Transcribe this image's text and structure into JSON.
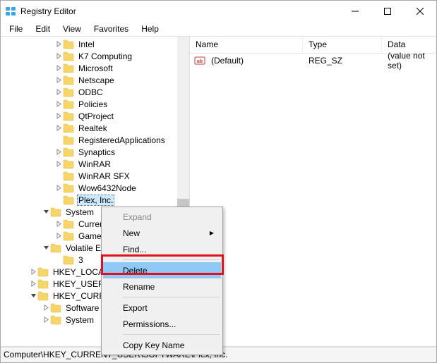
{
  "window": {
    "title": "Registry Editor"
  },
  "menubar": {
    "items": [
      "File",
      "Edit",
      "View",
      "Favorites",
      "Help"
    ]
  },
  "tree": {
    "items": [
      {
        "label": "Intel",
        "depth": 4,
        "exp": ">",
        "open": false
      },
      {
        "label": "K7 Computing",
        "depth": 4,
        "exp": ">",
        "open": false
      },
      {
        "label": "Microsoft",
        "depth": 4,
        "exp": ">",
        "open": false
      },
      {
        "label": "Netscape",
        "depth": 4,
        "exp": ">",
        "open": false
      },
      {
        "label": "ODBC",
        "depth": 4,
        "exp": ">",
        "open": false
      },
      {
        "label": "Policies",
        "depth": 4,
        "exp": ">",
        "open": false
      },
      {
        "label": "QtProject",
        "depth": 4,
        "exp": ">",
        "open": false
      },
      {
        "label": "Realtek",
        "depth": 4,
        "exp": ">",
        "open": false
      },
      {
        "label": "RegisteredApplications",
        "depth": 4,
        "exp": "",
        "open": false
      },
      {
        "label": "Synaptics",
        "depth": 4,
        "exp": ">",
        "open": false
      },
      {
        "label": "WinRAR",
        "depth": 4,
        "exp": ">",
        "open": false
      },
      {
        "label": "WinRAR SFX",
        "depth": 4,
        "exp": "",
        "open": false
      },
      {
        "label": "Wow6432Node",
        "depth": 4,
        "exp": ">",
        "open": false
      },
      {
        "label": "Plex, Inc.",
        "depth": 4,
        "exp": "",
        "open": false,
        "selected": true
      },
      {
        "label": "System",
        "depth": 3,
        "exp": "v",
        "open": true
      },
      {
        "label": "CurrentControlSet",
        "depth": 4,
        "exp": ">",
        "open": false,
        "truncated": "Curren"
      },
      {
        "label": "GameConfigStore",
        "depth": 4,
        "exp": ">",
        "open": false,
        "truncated": "Game"
      },
      {
        "label": "Volatile Environment",
        "depth": 3,
        "exp": "v",
        "open": true,
        "truncated": "Volatile En"
      },
      {
        "label": "3",
        "depth": 4,
        "exp": "",
        "open": false
      },
      {
        "label": "HKEY_LOCAL_MACHINE",
        "depth": 2,
        "exp": ">",
        "open": false,
        "truncated": "HKEY_LOCAL"
      },
      {
        "label": "HKEY_USERS",
        "depth": 2,
        "exp": ">",
        "open": false,
        "truncated": "HKEY_USERS"
      },
      {
        "label": "HKEY_CURRENT_CONFIG",
        "depth": 2,
        "exp": "v",
        "open": true,
        "truncated": "HKEY_CURRE"
      },
      {
        "label": "Software",
        "depth": 3,
        "exp": ">",
        "open": false
      },
      {
        "label": "System",
        "depth": 3,
        "exp": ">",
        "open": false
      }
    ]
  },
  "list": {
    "headers": {
      "name": "Name",
      "type": "Type",
      "data": "Data"
    },
    "rows": [
      {
        "name": "(Default)",
        "type": "REG_SZ",
        "data": "(value not set)"
      }
    ]
  },
  "context_menu": {
    "items": [
      {
        "label": "Expand",
        "kind": "item",
        "disabled": true
      },
      {
        "label": "New",
        "kind": "submenu"
      },
      {
        "label": "Find...",
        "kind": "item"
      },
      {
        "kind": "sep"
      },
      {
        "label": "Delete",
        "kind": "item",
        "highlight": true
      },
      {
        "label": "Rename",
        "kind": "item"
      },
      {
        "kind": "sep"
      },
      {
        "label": "Export",
        "kind": "item"
      },
      {
        "label": "Permissions...",
        "kind": "item"
      },
      {
        "kind": "sep"
      },
      {
        "label": "Copy Key Name",
        "kind": "item"
      }
    ]
  },
  "statusbar": {
    "path": "Computer\\HKEY_CURRENT_USER\\SOFTWARE\\Plex, Inc."
  }
}
